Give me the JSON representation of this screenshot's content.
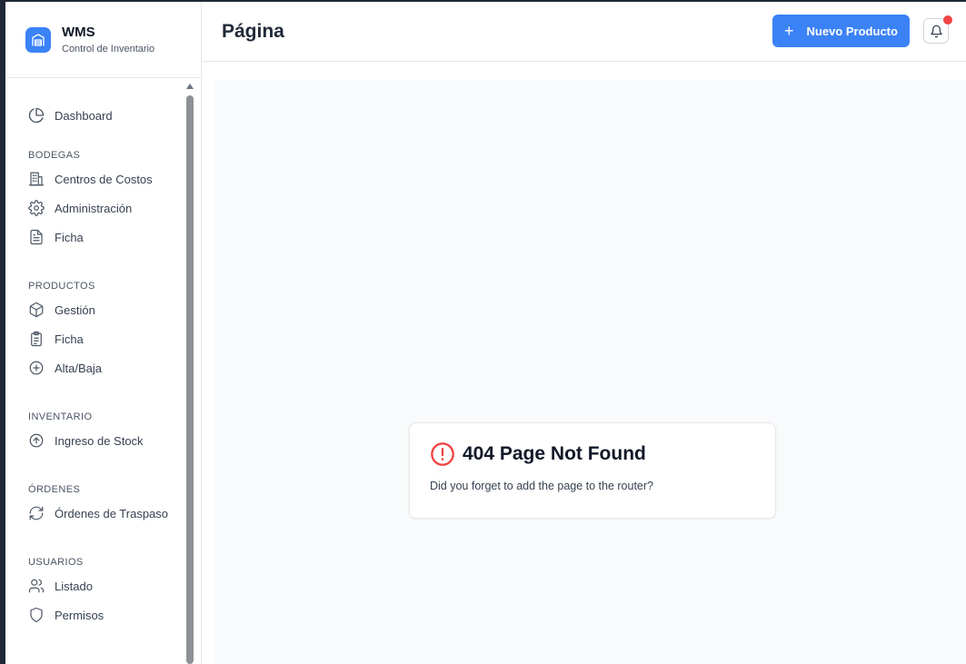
{
  "brand": {
    "title": "WMS",
    "subtitle": "Control de Inventario",
    "icon": "warehouse-icon",
    "accent": "#3b82f6"
  },
  "sidebar": {
    "dashboard": "Dashboard",
    "sections": {
      "bodegas": {
        "title": "BODEGAS",
        "items": [
          "Centros de Costos",
          "Administración",
          "Ficha"
        ]
      },
      "productos": {
        "title": "PRODUCTOS",
        "items": [
          "Gestión",
          "Ficha",
          "Alta/Baja"
        ]
      },
      "inventario": {
        "title": "INVENTARIO",
        "items": [
          "Ingreso de Stock"
        ]
      },
      "ordenes": {
        "title": "ÓRDENES",
        "items": [
          "Órdenes de Traspaso"
        ]
      },
      "usuarios": {
        "title": "USUARIOS",
        "items": [
          "Listado",
          "Permisos"
        ]
      }
    }
  },
  "header": {
    "title": "Página",
    "new_product_label": "Nuevo Producto",
    "notification_icon": "bell-icon",
    "notification_dot_color": "#ef4444"
  },
  "error_card": {
    "title": "404 Page Not Found",
    "message": "Did you forget to add the page to the router?",
    "icon": "alert-circle-icon",
    "icon_color": "#ef4444"
  }
}
